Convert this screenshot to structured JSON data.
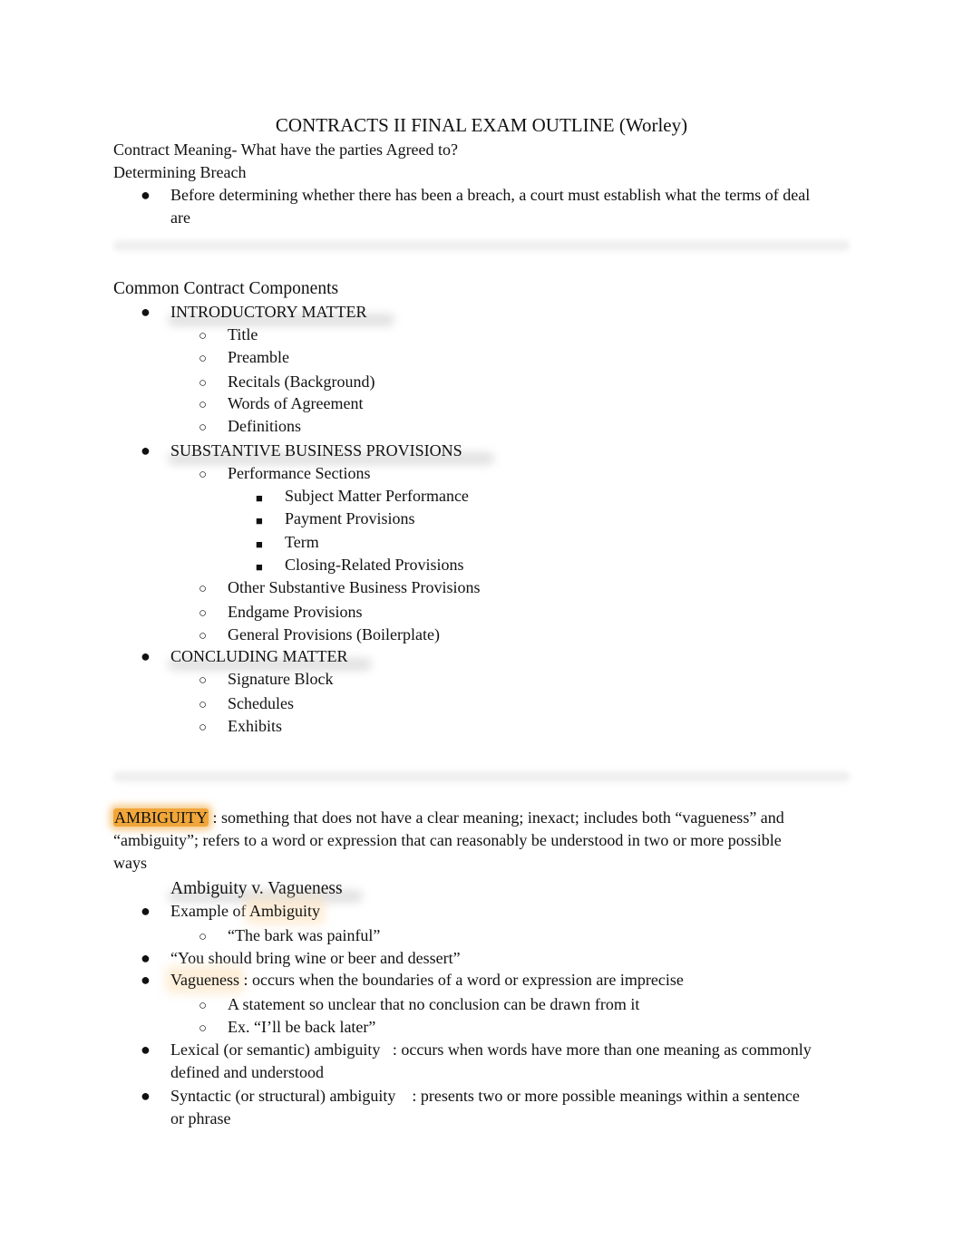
{
  "document": {
    "title": "CONTRACTS II FINAL EXAM OUTLINE (Worley)",
    "highlight_colors": {
      "strong": "#f0a63a",
      "soft": "#fde2be"
    }
  },
  "intro": {
    "heading1": "Contract Meaning- What have the parties Agreed to?",
    "heading2": "Determining Breach",
    "bullet_line1": "Before determining whether there has been a breach, a court must establish what the terms of deal",
    "bullet_line2": "are"
  },
  "components": {
    "heading": "Common Contract Components",
    "introductory": {
      "label": "INTRODUCTORY MATTER",
      "items": [
        "Title",
        "Preamble",
        "Recitals (Background)",
        "Words of Agreement",
        "Definitions"
      ]
    },
    "substantive": {
      "label": "SUBSTANTIVE BUSINESS PROVISIONS",
      "performance": "Performance Sections",
      "performance_items": [
        "Subject Matter Performance",
        "Payment Provisions",
        "Term",
        "Closing-Related Provisions"
      ],
      "other_items": [
        "Other Substantive Business Provisions",
        "Endgame Provisions",
        "General Provisions (Boilerplate)"
      ]
    },
    "concluding": {
      "label": "CONCLUDING MATTER",
      "items": [
        "Signature Block",
        "Schedules",
        "Exhibits"
      ]
    }
  },
  "ambiguity": {
    "term": "AMBIGUITY",
    "def_line1": " : something that does not have a clear meaning; inexact; includes both “vagueness” and",
    "def_line2": "“ambiguity”; refers to a word or expression that can reasonably be understood in two or more possible",
    "def_line3": "ways",
    "subheading": "Ambiguity v. Vagueness",
    "example_prefix": "Example of ",
    "example_term": "Ambiguity",
    "example_quote": "“The bark was painful”",
    "wine_quote": "“You should bring wine or beer and dessert”",
    "vagueness_term": "Vagueness",
    "vagueness_def": " : occurs when the boundaries of a word or expression are imprecise",
    "vagueness_sub1": "A statement so unclear that no conclusion can be drawn from it",
    "vagueness_sub2": "Ex. “I’ll be back later”",
    "lexical_line1": "Lexical (or semantic) ambiguity   : occurs when words have more than one meaning as commonly",
    "lexical_line2": "defined and understood",
    "syntactic_line1": "Syntactic (or structural) ambiguity    : presents two or more possible meanings within a sentence",
    "syntactic_line2": "or phrase"
  },
  "bullets": {
    "disc": "●",
    "circle": "○",
    "square": "■"
  }
}
